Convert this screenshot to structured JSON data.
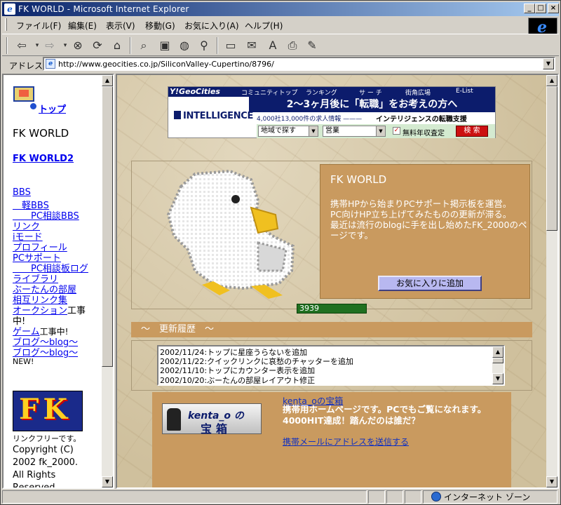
{
  "window": {
    "title": "FK WORLD - Microsoft Internet Explorer",
    "min_label": "_",
    "max_label": "□",
    "close_label": "×"
  },
  "menu": {
    "items": [
      "ファイル(F)",
      "編集(E)",
      "表示(V)",
      "移動(G)",
      "お気に入り(A)",
      "ヘルプ(H)"
    ]
  },
  "toolbar": {
    "icons": [
      "back-icon",
      "forward-icon",
      "stop-icon",
      "refresh-icon",
      "home-icon",
      "search-icon",
      "favorites-icon",
      "history-icon",
      "channels-icon",
      "fullscreen-icon",
      "mail-icon",
      "font-icon",
      "print-icon",
      "edit-icon"
    ]
  },
  "address": {
    "label": "アドレス",
    "url": "http://www.geocities.co.jp/SiliconValley-Cupertino/8796/"
  },
  "sidebar": {
    "top_link": "トップ",
    "site_title": "FK WORLD",
    "world2": "FK WORLD2",
    "links": [
      {
        "text": "BBS",
        "suffix": ""
      },
      {
        "text": "　軽BBS",
        "suffix": ""
      },
      {
        "text": "　　PC相談BBS",
        "suffix": ""
      },
      {
        "text": "リンク",
        "suffix": ""
      },
      {
        "text": "iモード",
        "suffix": ""
      },
      {
        "text": "プロフィール",
        "suffix": ""
      },
      {
        "text": "PCサポート",
        "suffix": ""
      },
      {
        "text": "　　PC相談板ログ",
        "suffix": ""
      },
      {
        "text": "ライブラリ",
        "suffix": ""
      },
      {
        "text": "ぶーたんの部屋",
        "suffix": ""
      },
      {
        "text": "相互リンク集",
        "suffix": ""
      },
      {
        "text": "オークション",
        "suffix": "工事"
      },
      {
        "text": "",
        "suffix": "中!"
      },
      {
        "text": "ゲーム",
        "suffix": "工事中!"
      },
      {
        "text": "ブログ〜blog〜",
        "suffix": ""
      },
      {
        "text": "ブログ〜blog〜",
        "suffix": ""
      }
    ],
    "new_label": "NEW!",
    "logo_text": "FK",
    "footer_lines": [
      "リンクフリーです。",
      "Copyright (C)",
      "2002 fk_2000.",
      "All Rights",
      "Reserved."
    ]
  },
  "banner": {
    "brand": "Y!GeoCities",
    "nav": [
      "コミュニティトップ",
      "ランキング",
      "サ ー チ",
      "街角広場",
      "E-List"
    ],
    "headline": "2〜3ヶ月後に「転職」をお考えの方へ",
    "company": "INTELLIGENCE",
    "sub1": "4,000社13,000件の求人情報 ———",
    "sub2": "インテリジェンスの転職支援",
    "select1": "地域で探す",
    "select2": "営業",
    "check_mark": "✓",
    "checkbox_label": "無料年収査定",
    "search_btn": "検 索"
  },
  "main": {
    "info_title": "FK WORLD",
    "info_lines": [
      "携帯HPから始まりPCサポート掲示板を運営。",
      "PC向けHP立ち上げてみたものの更新が滞る。",
      "最近は流行のblogに手を出し始めたFK_2000のページです。"
    ],
    "fav_button": "お気に入りに追加",
    "counter": "3939",
    "update_header": "〜　更新履歴　〜",
    "updates": [
      "2002/11/24:トップに星座うらないを追加",
      "2002/11/22:クイックリンクに哀愁のチャッターを追加",
      "2002/11/10:トップにカウンター表示を追加",
      "2002/10/20:ぶーたんの部屋レイアウト修正"
    ],
    "kenta_banner_top": "kenta_o の",
    "kenta_banner_bottom": "宝箱",
    "kenta_link": "kenta_oの宝箱",
    "kenta_desc": "携帯用ホームページです。PCでもご覧になれます。4000HIT達成！踏んだのは誰だ？",
    "kenta_mail": "携帯メールにアドレスを送信する"
  },
  "status": {
    "zone": "インターネット ゾーン"
  },
  "colors": {
    "title_start": "#0a246a",
    "link": "#0000ee",
    "panel": "#c99a5f",
    "counter": "#207020"
  }
}
